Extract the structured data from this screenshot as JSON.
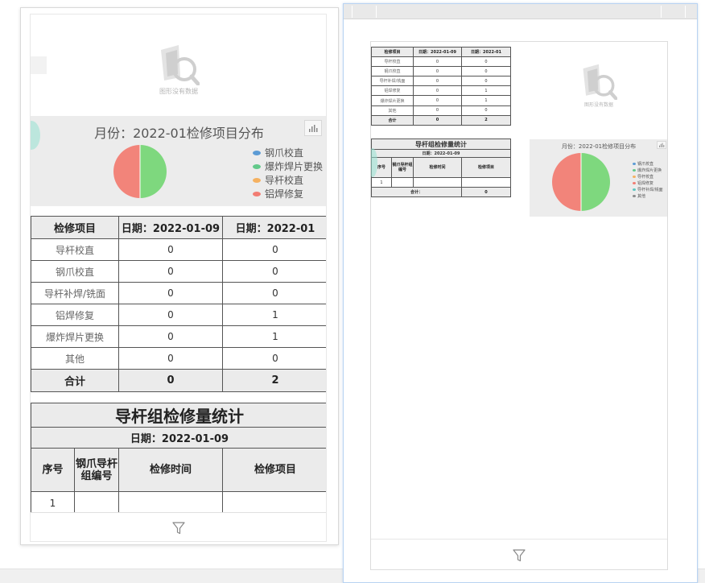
{
  "colors": {
    "slice_green": "#7ed87e",
    "slice_red": "#f2847a",
    "legend_blue": "#5b9bd5",
    "legend_green": "#62c98a",
    "legend_orange": "#f5b160",
    "legend_red": "#f27c72",
    "legend_teal": "#5cc6c0",
    "legend_gray": "#8a8a8a"
  },
  "mobile": {
    "nodata_text": "图形没有数据",
    "pie_title": "月份：2022-01检修项目分布",
    "legend": [
      {
        "label": "钢爪校直",
        "color": "#5b9bd5"
      },
      {
        "label": "爆炸焊片更换",
        "color": "#62c98a"
      },
      {
        "label": "导杆校直",
        "color": "#f5b160"
      },
      {
        "label": "铝焊修复",
        "color": "#f27c72"
      }
    ],
    "table1": {
      "headers": [
        "检修项目",
        "日期：2022-01-09",
        "日期：2022-01"
      ],
      "rows": [
        {
          "name": "导杆校直",
          "a": "0",
          "b": "0"
        },
        {
          "name": "钢爪校直",
          "a": "0",
          "b": "0"
        },
        {
          "name": "导杆补焊/铣面",
          "a": "0",
          "b": "0"
        },
        {
          "name": "铝焊修复",
          "a": "0",
          "b": "1"
        },
        {
          "name": "爆炸焊片更换",
          "a": "0",
          "b": "1"
        },
        {
          "name": "其他",
          "a": "0",
          "b": "0"
        }
      ],
      "total": {
        "label": "合计",
        "a": "0",
        "b": "2"
      }
    },
    "table2": {
      "title": "导杆组检修量统计",
      "date": "日期：2022-01-09",
      "headers": [
        "序号",
        "钢爪导杆组编号",
        "检修时间",
        "检修项目"
      ],
      "rows": [
        {
          "seq": "1",
          "code": "",
          "time": "",
          "item": ""
        }
      ]
    }
  },
  "preview": {
    "nodata_text": "图形没有数据",
    "pie_title": "月份：2022-01检修项目分布",
    "legend": [
      {
        "label": "钢爪校直",
        "color": "#5b9bd5"
      },
      {
        "label": "爆炸焊片更换",
        "color": "#62c98a"
      },
      {
        "label": "导杆校直",
        "color": "#f5b160"
      },
      {
        "label": "铝焊修复",
        "color": "#f27c72"
      },
      {
        "label": "导杆补焊/铣面",
        "color": "#5cc6c0"
      },
      {
        "label": "其他",
        "color": "#8a8a8a"
      }
    ],
    "table1": {
      "headers": [
        "检修项目",
        "日期：2022-01-09",
        "日期：2022-01"
      ],
      "rows": [
        {
          "name": "导杆校直",
          "a": "0",
          "b": "0"
        },
        {
          "name": "钢爪校直",
          "a": "0",
          "b": "0"
        },
        {
          "name": "导杆补焊/铣面",
          "a": "0",
          "b": "0"
        },
        {
          "name": "铝焊修复",
          "a": "0",
          "b": "1"
        },
        {
          "name": "爆炸焊片更换",
          "a": "0",
          "b": "1"
        },
        {
          "name": "其他",
          "a": "0",
          "b": "0"
        }
      ],
      "total": {
        "label": "合计",
        "a": "0",
        "b": "2"
      }
    },
    "table2": {
      "title": "导杆组检修量统计",
      "date": "日期：2022-01-09",
      "headers": [
        "序号",
        "钢爪导杆组编号",
        "检修时间",
        "检修项目"
      ],
      "rows": [
        {
          "seq": "1",
          "code": "",
          "time": "",
          "item": ""
        }
      ],
      "total": {
        "label": "合计：",
        "value": "0"
      }
    }
  },
  "chart_data": [
    {
      "type": "pie",
      "title": "月份：2022-01检修项目分布",
      "categories": [
        "钢爪校直",
        "爆炸焊片更换",
        "导杆校直",
        "铝焊修复"
      ],
      "values": [
        0,
        1,
        0,
        1
      ],
      "legend": "right"
    },
    {
      "type": "pie",
      "title": "月份：2022-01检修项目分布",
      "categories": [
        "钢爪校直",
        "爆炸焊片更换",
        "导杆校直",
        "铝焊修复",
        "导杆补焊/铣面",
        "其他"
      ],
      "values": [
        0,
        1,
        0,
        1,
        0,
        0
      ],
      "legend": "right"
    }
  ]
}
